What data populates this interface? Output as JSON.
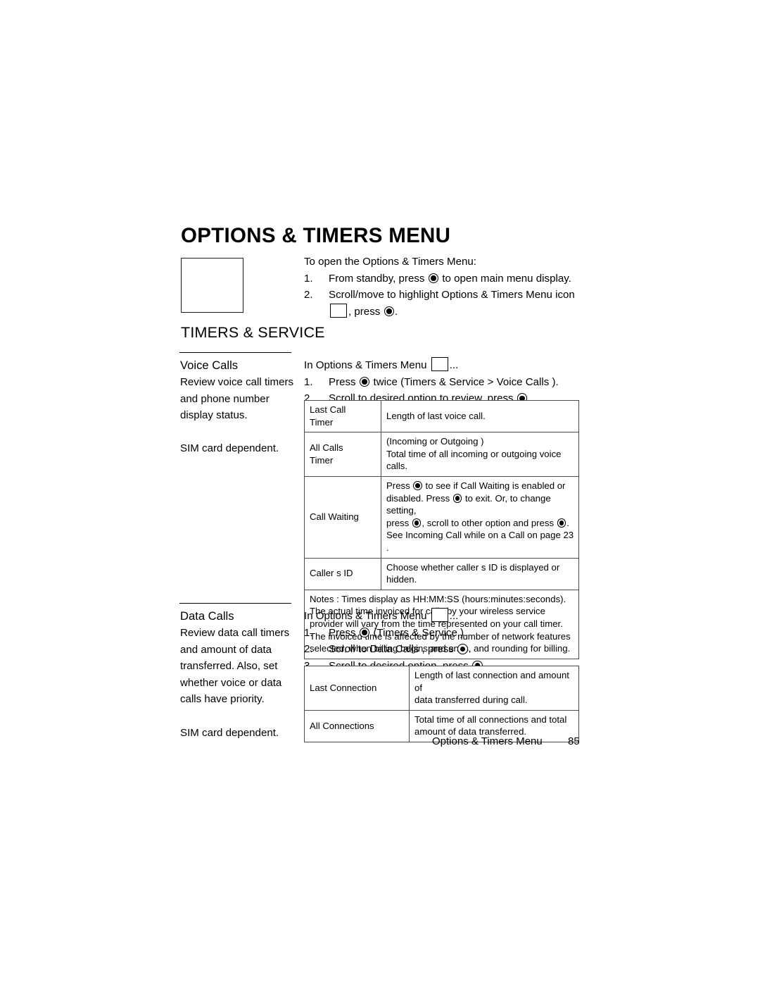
{
  "page": {
    "title": "OPTIONS & TIMERS MENU",
    "footer_title": "Options & Timers Menu",
    "footer_page": "85"
  },
  "intro": {
    "lead": "To open the Options & Timers Menu:",
    "steps": [
      {
        "num": "1.",
        "before": "From standby, press",
        "after": "to open main menu display."
      },
      {
        "num": "2.",
        "before": "Scroll/move to highlight Options & Timers Menu icon",
        "after": ""
      }
    ],
    "step2_continuation_before": "",
    "step2_continuation_after": ", press",
    "step2_tail": "."
  },
  "section": {
    "heading": "TIMERS & SERVICE"
  },
  "voice_calls": {
    "name": "Voice Calls",
    "description_lines": [
      "Review voice call timers",
      "and phone number",
      "display status."
    ],
    "note": "SIM card dependent.",
    "menu_path_before": "In Options & Timers Menu",
    "menu_path_after": "...",
    "steps": [
      {
        "num": "1.",
        "before": "Press",
        "after": "twice (Timers & Service  > Voice  Calls )."
      },
      {
        "num": "2.",
        "before": "Scroll to desired option to review, press",
        "after": "."
      }
    ],
    "table": {
      "rows": [
        {
          "label": "Last Call\nTimer",
          "desc_lines": [
            "Length of last voice call."
          ]
        },
        {
          "label": "All Calls\nTimer",
          "desc_lines": [
            "(Incoming  or Outgoing )",
            "Total time of all incoming or outgoing voice calls."
          ]
        },
        {
          "label": "Call Waiting",
          "desc_lines": [
            "Press @ to see if Call Waiting is enabled or",
            "disabled. Press @ to exit. Or, to change setting,",
            "press @, scroll to other option and press @.",
            "See  Incoming Call while on a Call  on page 23 ."
          ]
        },
        {
          "label": "Caller s ID",
          "desc_lines": [
            "Choose whether caller s ID is displayed or",
            "hidden."
          ]
        }
      ],
      "notes_lines": [
        "Notes : Times display as HH:MM:SS (hours:minutes:seconds).",
        "The actual time invoiced for calls by your wireless service",
        "provider will vary from the time represented on your call timer.",
        "The invoiced time is affected by the number of network features",
        "selected, when billing begins and ends, and rounding for billing."
      ]
    }
  },
  "data_calls": {
    "name": "Data Calls",
    "description_lines": [
      "Review data call timers",
      "and amount of data",
      "transferred. Also, set",
      "whether voice or data",
      "calls have priority."
    ],
    "note": "SIM card dependent.",
    "menu_path_before": "In Options & Timers Menu",
    "menu_path_after": "...",
    "steps": [
      {
        "num": "1.",
        "before": "Press",
        "after": "(Timers & Service )."
      },
      {
        "num": "2.",
        "before": "Scroll to Data Calls , press",
        "after": "."
      },
      {
        "num": "3.",
        "before": "Scroll to desired option, press",
        "after": "."
      }
    ],
    "table": {
      "rows": [
        {
          "label": "Last Connection",
          "desc_lines": [
            "Length of last connection and amount of",
            "data transferred during call."
          ]
        },
        {
          "label": "All Connections",
          "desc_lines": [
            "Total time of all connections and total",
            "amount of data transferred."
          ]
        }
      ]
    }
  }
}
